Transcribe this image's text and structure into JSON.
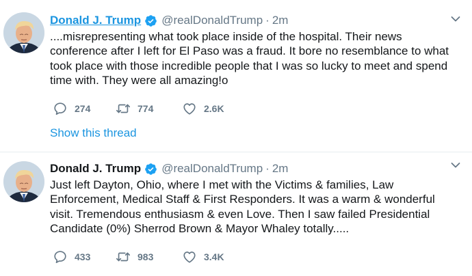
{
  "tweets": [
    {
      "name": "Donald J. Trump",
      "handle": "@realDonaldTrump",
      "separator": "·",
      "time": "2m",
      "text": "....misrepresenting what took place inside of the hospital. Their news conference after I left for El Paso was a fraud. It bore no resemblance to what took place with those incredible people that I was so lucky to meet and spend time with. They were all amazing!o",
      "replies": "274",
      "retweets": "774",
      "likes": "2.6K",
      "show_thread": "Show this thread"
    },
    {
      "name": "Donald J. Trump",
      "handle": "@realDonaldTrump",
      "separator": "·",
      "time": "2m",
      "text": "Just left Dayton, Ohio, where I met with the Victims & families, Law Enforcement, Medical Staff & First Responders. It was a warm & wonderful visit. Tremendous enthusiasm & even Love. Then I saw failed Presidential Candidate (0%) Sherrod Brown & Mayor Whaley totally.....",
      "replies": "433",
      "retweets": "983",
      "likes": "3.4K"
    }
  ],
  "colors": {
    "link": "#1b95e0",
    "text": "#14171a",
    "muted": "#657786",
    "verified": "#1da1f2"
  },
  "icons": [
    "verified-icon",
    "caret-down-icon",
    "reply-icon",
    "retweet-icon",
    "like-icon"
  ]
}
